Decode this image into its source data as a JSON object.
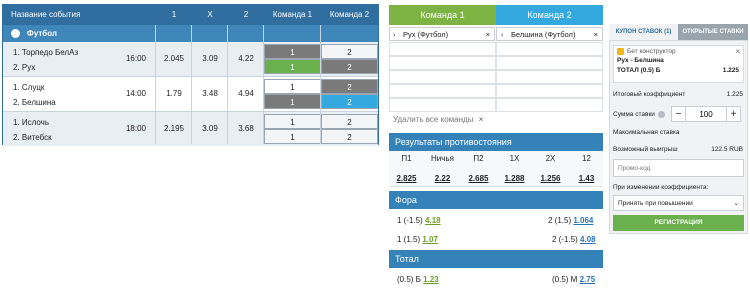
{
  "events_table": {
    "headers": {
      "event": "Название события",
      "one": "1",
      "x": "X",
      "two": "2",
      "team1": "Команда 1",
      "team2": "Команда 2"
    },
    "category": "Футбол",
    "events": [
      {
        "team1": "1. Торпедо БелАз",
        "team2": "2. Рух",
        "time": "16:00",
        "odd1": "2.045",
        "oddx": "3.09",
        "odd2": "4.22",
        "pick1": [
          "1",
          "1"
        ],
        "pick2": [
          "2",
          "2"
        ]
      },
      {
        "team1": "1. Слуцк",
        "team2": "2. Белшина",
        "time": "14:00",
        "odd1": "1.79",
        "oddx": "3.48",
        "odd2": "4.94",
        "pick1": [
          "1",
          "1"
        ],
        "pick2": [
          "2",
          "2"
        ]
      },
      {
        "team1": "1. Ислочь",
        "team2": "2. Витебск",
        "time": "18:00",
        "odd1": "2.195",
        "oddx": "3.09",
        "odd2": "3.68",
        "pick1": [
          "1",
          "1"
        ],
        "pick2": [
          "2",
          "2"
        ]
      }
    ]
  },
  "constructor": {
    "tab_team1": "Команда 1",
    "tab_team2": "Команда 2",
    "selected_team1": "Рух (Футбол)",
    "selected_team2": "Белшина (Футбол)",
    "remove_all": "Удалить все команды",
    "results_title": "Результаты противостояния",
    "results": [
      {
        "label": "П1",
        "value": "2.825"
      },
      {
        "label": "Ничья",
        "value": "2.22"
      },
      {
        "label": "П2",
        "value": "2.685"
      },
      {
        "label": "1Х",
        "value": "1.288"
      },
      {
        "label": "2Х",
        "value": "1.256"
      },
      {
        "label": "12",
        "value": "1.43"
      }
    ],
    "handicap_title": "Фора",
    "handicap": [
      {
        "left_label": "1 (-1.5)",
        "left_value": "4.18",
        "right_label": "2 (1.5)",
        "right_value": "1.064"
      },
      {
        "left_label": "1 (1.5)",
        "left_value": "1.07",
        "right_label": "2 (-1.5)",
        "right_value": "4.08"
      }
    ],
    "total_title": "Тотал",
    "total": [
      {
        "left_label": "(0.5) Б",
        "left_value": "1.23",
        "right_label": "(0.5) М",
        "right_value": "2.75"
      }
    ]
  },
  "coupon": {
    "tab_active": "КУПОН СТАВОК (1)",
    "tab_other": "ОТКРЫТЫЕ СТАВКИ",
    "bet_type": "Бет конструктор",
    "match": "Рух - Белшина",
    "selection": "ТОТАЛ (0.5) Б",
    "selection_odd": "1.225",
    "total_coef_label": "Итоговый коэффициент",
    "total_coef_value": "1.225",
    "stake_label": "Сумма ставки",
    "stake_value": "100",
    "minus": "−",
    "plus": "+",
    "max_stake_label": "Максимальная ставка",
    "possible_win_label": "Возможный выигрыш",
    "possible_win_value": "122.5 RUB",
    "promo_placeholder": "Промо-код",
    "coef_change_label": "При изменении коэффициента:",
    "coef_change_option": "Принять при повышении",
    "register_button": "РЕГИСТРАЦИЯ"
  },
  "colors": {
    "header_blue": "#2f6e9f",
    "team1_green": "#7cb342",
    "team2_blue": "#33a9e0",
    "accent_green": "#6ab04c"
  }
}
